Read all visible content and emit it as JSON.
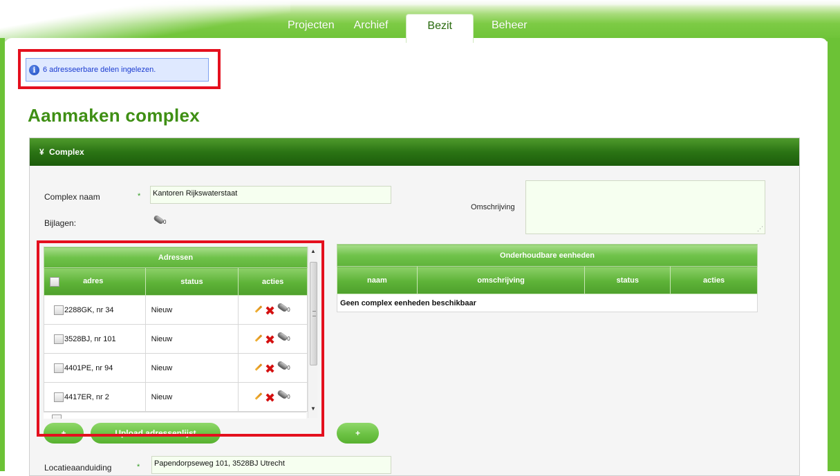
{
  "nav": {
    "tabs": [
      "Projecten",
      "Archief",
      "Bezit",
      "Beheer"
    ],
    "active_tab": "Bezit"
  },
  "message": {
    "icon": "info-icon",
    "text": "6 adresseerbare delen ingelezen."
  },
  "page_title": "Aanmaken complex",
  "panel": {
    "toggle": "¥",
    "title": "Complex"
  },
  "form": {
    "complex_naam_label": "Complex naam",
    "complex_naam_value": "Kantoren Rijkswaterstaat",
    "required_marker": "*",
    "bijlagen_label": "Bijlagen:",
    "bijlagen_count": "0",
    "omschrijving_label": "Omschrijving",
    "omschrijving_value": "",
    "locatie_label": "Locatieaanduiding",
    "locatie_value": "Papendorpseweg 101, 3528BJ Utrecht"
  },
  "adressen_table": {
    "caption": "Adressen",
    "columns": [
      "adres",
      "status",
      "acties"
    ],
    "rows": [
      {
        "adres": "2288GK, nr 34",
        "status": "Nieuw",
        "attachments": "0"
      },
      {
        "adres": "3528BJ, nr 101",
        "status": "Nieuw",
        "attachments": "0"
      },
      {
        "adres": "4401PE, nr 94",
        "status": "Nieuw",
        "attachments": "0"
      },
      {
        "adres": "4417ER, nr 2",
        "status": "Nieuw",
        "attachments": "0"
      }
    ]
  },
  "eenheden_table": {
    "caption": "Onderhoudbare eenheden",
    "columns": [
      "naam",
      "omschrijving",
      "status",
      "acties"
    ],
    "empty_text": "Geen complex eenheden beschikbaar"
  },
  "buttons": {
    "add_address": "+",
    "upload": "Upload adressenlijst",
    "add_unit": "+"
  },
  "colors": {
    "brand_green": "#3f8f14",
    "header_green": "#2b7414",
    "highlight_red": "#e4101e",
    "info_bg": "#dfe9ff"
  }
}
